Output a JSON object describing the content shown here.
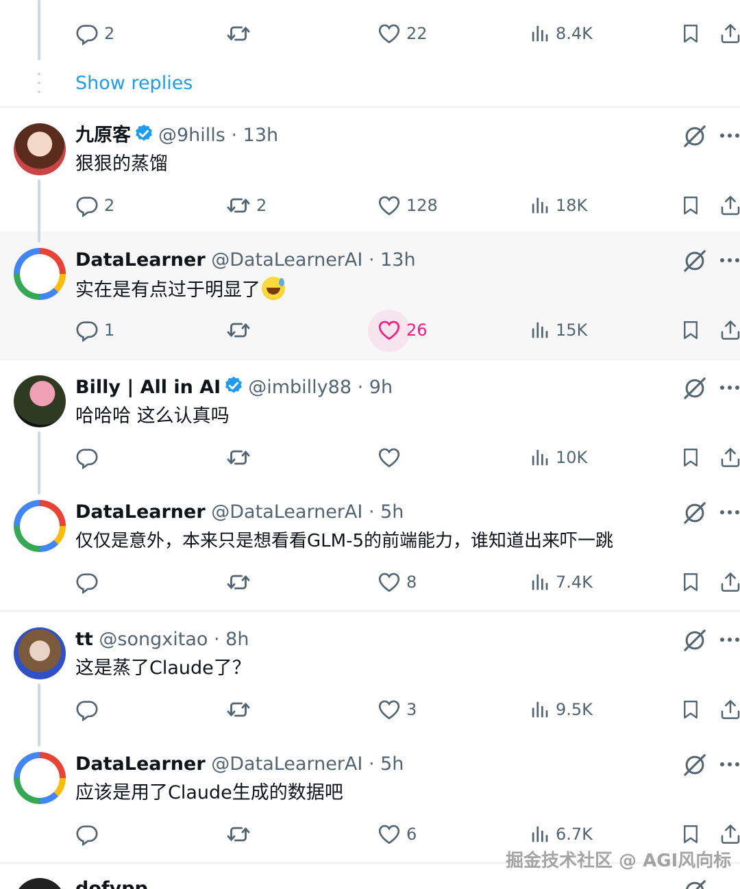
{
  "top_partial_text": "",
  "show_replies_label": "Show replies",
  "posts": [
    {
      "id": "p0",
      "counts": {
        "replies": "2",
        "reposts": "",
        "likes": "22",
        "views": "8.4K"
      }
    },
    {
      "id": "p1",
      "name": "九原客",
      "verified": true,
      "handle": "@9hills",
      "sep": "·",
      "time": "13h",
      "text": "狠狠的蒸馏",
      "counts": {
        "replies": "2",
        "reposts": "2",
        "likes": "128",
        "views": "18K"
      }
    },
    {
      "id": "p2",
      "name": "DataLearner",
      "verified": false,
      "handle": "@DataLearnerAI",
      "sep": "·",
      "time": "13h",
      "text": "实在是有点过于明显了",
      "emoji": "sweat-smile-emoji",
      "liked": true,
      "counts": {
        "replies": "1",
        "reposts": "",
        "likes": "26",
        "views": "15K"
      }
    },
    {
      "id": "p3",
      "name": "Billy | All in AI",
      "verified": true,
      "handle": "@imbilly88",
      "sep": "·",
      "time": "9h",
      "text": "哈哈哈 这么认真吗",
      "counts": {
        "replies": "",
        "reposts": "",
        "likes": "",
        "views": "10K"
      }
    },
    {
      "id": "p4",
      "name": "DataLearner",
      "verified": false,
      "handle": "@DataLearnerAI",
      "sep": "·",
      "time": "5h",
      "text": "仅仅是意外，本来只是想看看GLM-5的前端能力，谁知道出来吓一跳",
      "counts": {
        "replies": "",
        "reposts": "",
        "likes": "8",
        "views": "7.4K"
      }
    },
    {
      "id": "p5",
      "name": "tt",
      "verified": false,
      "handle": "@songxitao",
      "sep": "·",
      "time": "8h",
      "text": "这是蒸了Claude了？",
      "counts": {
        "replies": "",
        "reposts": "",
        "likes": "3",
        "views": "9.5K"
      }
    },
    {
      "id": "p6",
      "name": "DataLearner",
      "verified": false,
      "handle": "@DataLearnerAI",
      "sep": "·",
      "time": "5h",
      "text": "应该是用了Claude生成的数据吧",
      "counts": {
        "replies": "",
        "reposts": "",
        "likes": "6",
        "views": "6.7K"
      }
    }
  ],
  "bottom_partial_text": "dofypp",
  "watermark": "掘金技术社区 @ AGI风向标",
  "colors": {
    "link": "#1d9bf0",
    "muted": "#536471",
    "like_active": "#f91880",
    "verified": "#1d9bf0",
    "thread_line": "#cfd9de",
    "highlight_bg": "#f7f7f7"
  },
  "icons": [
    "reply-icon",
    "repost-icon",
    "like-icon",
    "views-icon",
    "bookmark-icon",
    "share-icon",
    "grok-icon",
    "more-icon",
    "verified-badge-icon"
  ]
}
